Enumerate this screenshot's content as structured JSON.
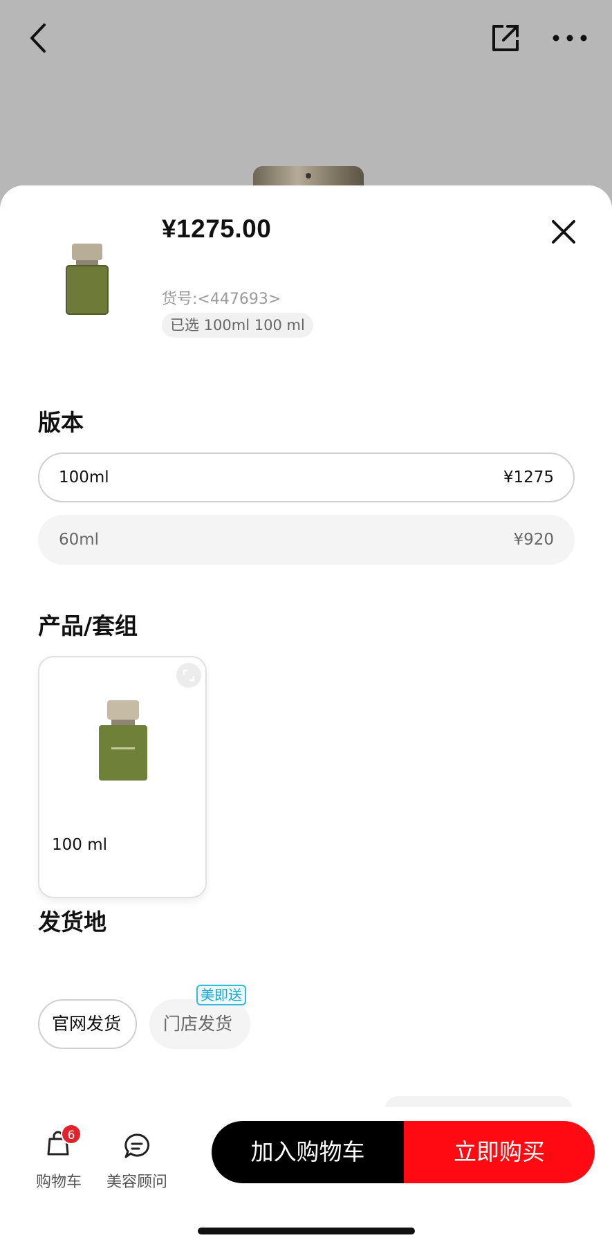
{
  "header": {
    "back_icon": "chevron-left-icon",
    "share_icon": "share-icon",
    "more_icon": "more-dots-icon"
  },
  "sheet": {
    "price": "¥1275.00",
    "sku": "货号:<447693>",
    "selected": "已选 100ml 100 ml",
    "close_icon": "close-icon"
  },
  "version": {
    "title": "版本",
    "options": [
      {
        "label": "100ml",
        "price": "¥1275",
        "selected": true
      },
      {
        "label": "60ml",
        "price": "¥920",
        "selected": false
      }
    ]
  },
  "product": {
    "title": "产品/套组",
    "items": [
      {
        "label": "100 ml",
        "selected": true
      }
    ]
  },
  "shipping": {
    "title": "发货地",
    "options": [
      {
        "label": "官网发货",
        "selected": true
      },
      {
        "label": "门店发货",
        "selected": false,
        "badge": "美即送"
      }
    ]
  },
  "bottom": {
    "cart_label": "购物车",
    "cart_count": "6",
    "advisor_label": "美容顾问",
    "add_to_cart": "加入购物车",
    "buy_now": "立即购买"
  },
  "colors": {
    "accent_red": "#ff0a12",
    "badge_red": "#e1242c",
    "badge_cyan": "#36b9d8",
    "primary_black": "#000000"
  }
}
